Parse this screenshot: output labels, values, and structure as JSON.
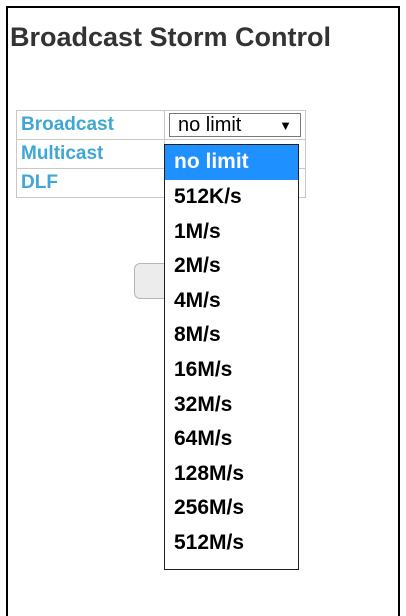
{
  "page": {
    "title": "Broadcast Storm Control"
  },
  "rows": [
    {
      "label": "Broadcast",
      "value": "no limit"
    },
    {
      "label": "Multicast",
      "value": ""
    },
    {
      "label": "DLF",
      "value": ""
    }
  ],
  "dropdown": {
    "selected": "no limit",
    "options": [
      "no limit",
      "512K/s",
      "1M/s",
      "2M/s",
      "4M/s",
      "8M/s",
      "16M/s",
      "32M/s",
      "64M/s",
      "128M/s",
      "256M/s",
      "512M/s"
    ]
  },
  "colors": {
    "label": "#3fa7d6",
    "highlight": "#1e90ff"
  }
}
